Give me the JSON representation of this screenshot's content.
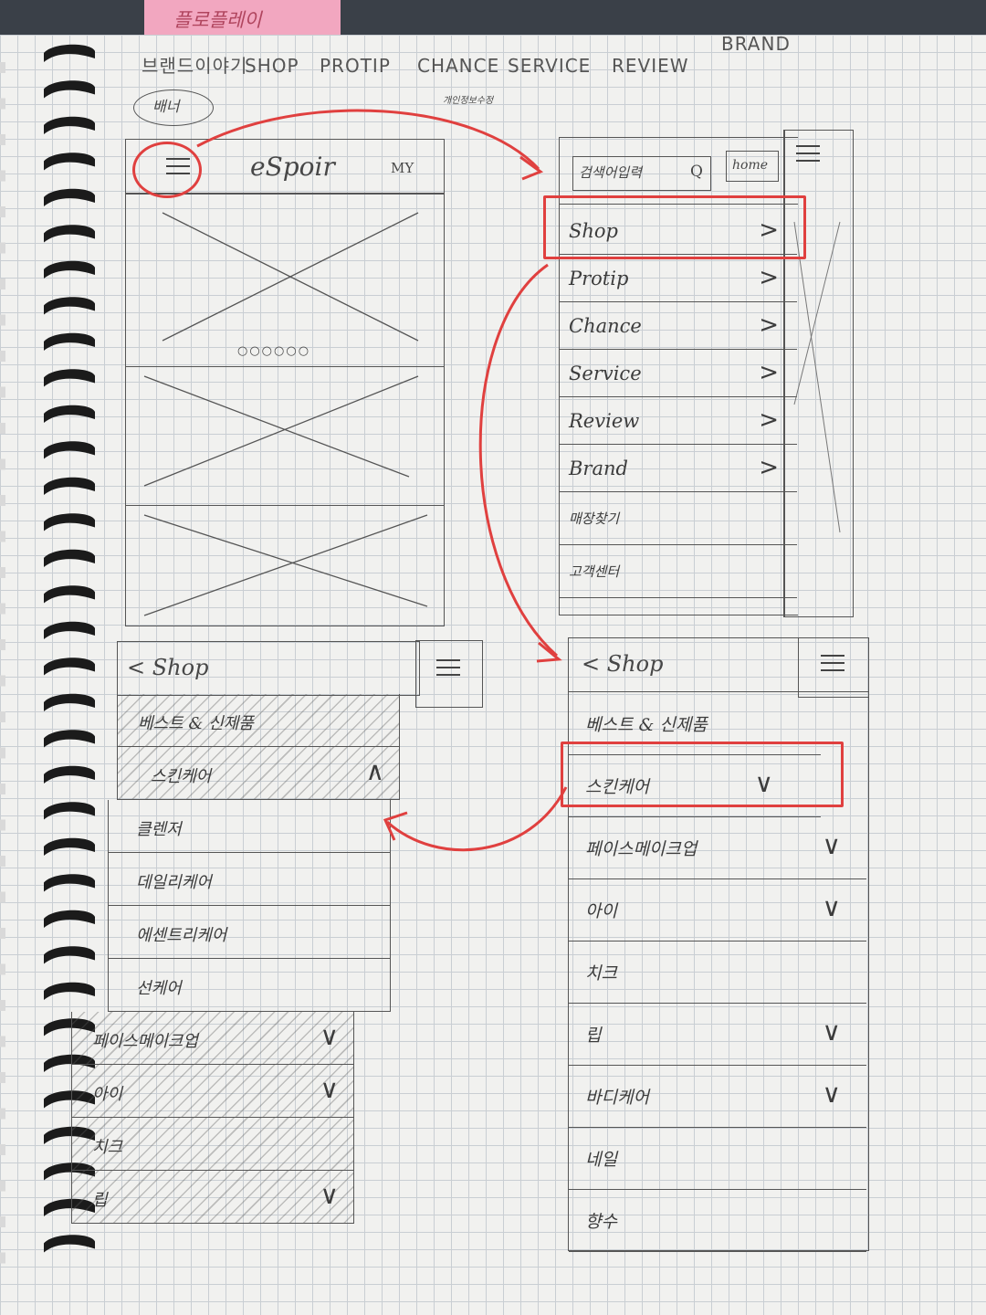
{
  "sticky_note": "플로플레이",
  "top_nav": {
    "items": [
      "브랜드이야기",
      "SHOP",
      "PROTIP",
      "CHANCE",
      "SERVICE",
      "REVIEW",
      "BRAND"
    ],
    "circled_label": "배너",
    "small_note": "개인정보수정"
  },
  "home_screen": {
    "logo": "eSpoir",
    "my_label": "MY",
    "carousel_dots": "○○○○○○"
  },
  "side_menu": {
    "search_placeholder": "검색어입력",
    "search_icon": "Q",
    "home_button": "home",
    "items": [
      "Shop",
      "Protip",
      "Chance",
      "Service",
      "Review",
      "Brand"
    ],
    "extra_items": [
      "매장찾기",
      "고객센터"
    ]
  },
  "shop_menu": {
    "back_title": "< Shop",
    "items": [
      {
        "label": "베스트 & 신제품",
        "chevron": ""
      },
      {
        "label": "스킨케어",
        "chevron": "∨"
      },
      {
        "label": "페이스메이크업",
        "chevron": "∨"
      },
      {
        "label": "아이",
        "chevron": "∨"
      },
      {
        "label": "치크",
        "chevron": ""
      },
      {
        "label": "립",
        "chevron": "∨"
      },
      {
        "label": "바디케어",
        "chevron": "∨"
      },
      {
        "label": "네일",
        "chevron": ""
      },
      {
        "label": "향수",
        "chevron": ""
      }
    ]
  },
  "shop_expanded": {
    "back_title": "< Shop",
    "items": [
      {
        "label": "베스트 & 신제품",
        "chevron": ""
      },
      {
        "label": "스킨케어",
        "chevron": "∧"
      },
      {
        "label": "클렌저",
        "chevron": ""
      },
      {
        "label": "데일리케어",
        "chevron": ""
      },
      {
        "label": "에센트리케어",
        "chevron": ""
      },
      {
        "label": "선케어",
        "chevron": ""
      },
      {
        "label": "페이스메이크업",
        "chevron": "∨"
      },
      {
        "label": "아이",
        "chevron": "∨"
      },
      {
        "label": "치크",
        "chevron": ""
      },
      {
        "label": "립",
        "chevron": "∨"
      }
    ]
  },
  "colors": {
    "annotation_red": "#e0403f",
    "pencil": "#474747",
    "paper": "#f1f1ef"
  }
}
